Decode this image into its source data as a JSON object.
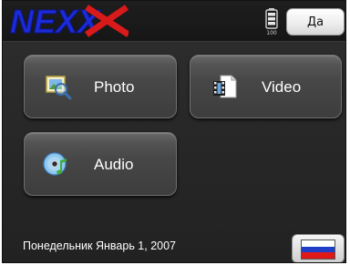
{
  "header": {
    "logo_text": "NEXX",
    "confirm_label": "Да",
    "battery_caption": "100"
  },
  "tiles": [
    {
      "label": "Photo",
      "icon": "photo-icon"
    },
    {
      "label": "Video",
      "icon": "video-icon"
    },
    {
      "label": "Audio",
      "icon": "audio-icon"
    }
  ],
  "footer": {
    "date_text": "Понедельник Январь 1, 2007",
    "language_flag": "russian-flag-icon"
  },
  "colors": {
    "logo_blue": "#1c2bd6",
    "logo_red": "#d81a1a",
    "flag_white": "#ffffff",
    "flag_blue": "#1f3fc8",
    "flag_red": "#e01818"
  }
}
